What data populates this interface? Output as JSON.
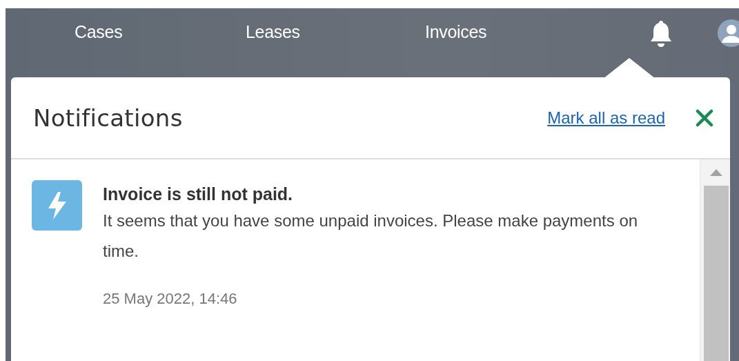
{
  "nav": {
    "tabs": [
      {
        "label": "Cases"
      },
      {
        "label": "Leases"
      },
      {
        "label": "Invoices"
      }
    ]
  },
  "notifications_panel": {
    "title": "Notifications",
    "mark_all_link": "Mark all as read",
    "items": [
      {
        "title": "Invoice is still not paid.",
        "body": "It seems that you have some unpaid invoices. Please make payments on time.",
        "time": "25 May 2022, 14:46"
      }
    ]
  }
}
